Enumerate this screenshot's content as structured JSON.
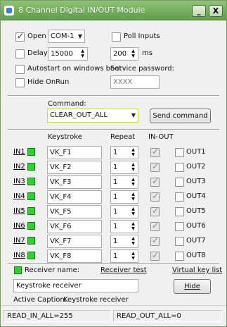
{
  "window": {
    "title": "8 Channel Digital IN/OUT Module",
    "buttons": {
      "minimize": "_",
      "close": "X"
    }
  },
  "settings": {
    "open_label": "Open",
    "port_value": "COM-1",
    "poll_inputs_label": "Poll Inputs",
    "delay_label": "Delay",
    "delay_value": "15000",
    "poll_value": "200",
    "poll_unit": "ms",
    "autostart_label": "Autostart on windows boot",
    "service_password_label": "Service password:",
    "password_value": "XXXX",
    "hide_onrun_label": "Hide OnRun"
  },
  "command": {
    "label": "Command:",
    "value": "CLEAR_OUT_ALL",
    "send_button": "Send command"
  },
  "table": {
    "headers": {
      "keystroke": "Keystroke",
      "repeat": "Repeat",
      "inout": "IN-OUT"
    },
    "rows": [
      {
        "in": "IN1",
        "key": "VK_F1",
        "repeat": "1",
        "out": "OUT1"
      },
      {
        "in": "IN2",
        "key": "VK_F2",
        "repeat": "1",
        "out": "OUT2"
      },
      {
        "in": "IN3",
        "key": "VK_F3",
        "repeat": "1",
        "out": "OUT3"
      },
      {
        "in": "IN4",
        "key": "VK_F4",
        "repeat": "1",
        "out": "OUT4"
      },
      {
        "in": "IN5",
        "key": "VK_F5",
        "repeat": "1",
        "out": "OUT5"
      },
      {
        "in": "IN6",
        "key": "VK_F6",
        "repeat": "1",
        "out": "OUT6"
      },
      {
        "in": "IN7",
        "key": "VK_F7",
        "repeat": "1",
        "out": "OUT7"
      },
      {
        "in": "IN8",
        "key": "VK_F8",
        "repeat": "1",
        "out": "OUT8"
      }
    ]
  },
  "receiver": {
    "name_label": "Receiver name:",
    "test_link": "Receiver test",
    "virtual_link": "Virtual key list",
    "name_value": "Keystroke receiver",
    "hide_button": "Hide",
    "caption_label": "Active Caption:",
    "caption_value": "Keystroke receiver"
  },
  "status": {
    "left": "READ_IN_ALL=255",
    "right": "READ_OUT_ALL=0"
  },
  "colors": {
    "titlebar": "#6faa58",
    "indicator": "#2fd12f"
  }
}
